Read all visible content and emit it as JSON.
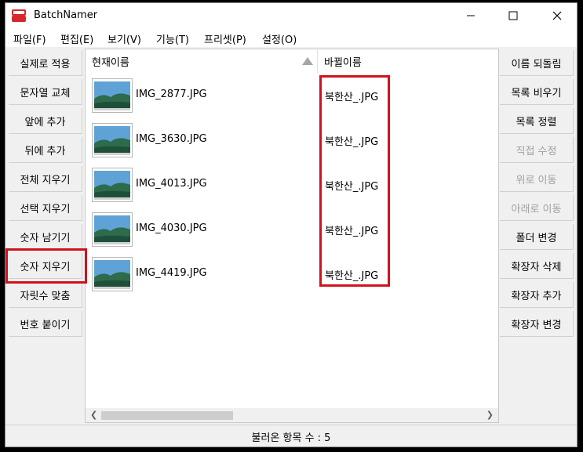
{
  "window": {
    "title": "BatchNamer"
  },
  "menu": [
    "파일(F)",
    "편집(E)",
    "보기(V)",
    "기능(T)",
    "프리셋(P)",
    "설정(O)"
  ],
  "left_buttons": [
    {
      "label": "실제로 적용",
      "enabled": true
    },
    {
      "label": "문자열 교체",
      "enabled": true
    },
    {
      "label": "앞에 추가",
      "enabled": true
    },
    {
      "label": "뒤에 추가",
      "enabled": true
    },
    {
      "label": "전체 지우기",
      "enabled": true
    },
    {
      "label": "선택 지우기",
      "enabled": true
    },
    {
      "label": "숫자 남기기",
      "enabled": true
    },
    {
      "label": "숫자 지우기",
      "enabled": true
    },
    {
      "label": "자릿수 맞춤",
      "enabled": true
    },
    {
      "label": "번호 붙이기",
      "enabled": true
    }
  ],
  "right_buttons": [
    {
      "label": "이름 되돌림",
      "enabled": true
    },
    {
      "label": "목록 비우기",
      "enabled": true
    },
    {
      "label": "목록 정렬",
      "enabled": true
    },
    {
      "label": "직접 수정",
      "enabled": false
    },
    {
      "label": "위로 이동",
      "enabled": false
    },
    {
      "label": "아래로 이동",
      "enabled": false
    },
    {
      "label": "폴더 변경",
      "enabled": true
    },
    {
      "label": "확장자 삭제",
      "enabled": true
    },
    {
      "label": "확장자 추가",
      "enabled": true
    },
    {
      "label": "확장자 변경",
      "enabled": true
    }
  ],
  "columns": {
    "current": "현재이름",
    "new": "바뀔이름"
  },
  "files": [
    {
      "current": "IMG_2877.JPG",
      "new": "북한산_.JPG"
    },
    {
      "current": "IMG_3630.JPG",
      "new": "북한산_.JPG"
    },
    {
      "current": "IMG_4013.JPG",
      "new": "북한산_.JPG"
    },
    {
      "current": "IMG_4030.JPG",
      "new": "북한산_.JPG"
    },
    {
      "current": "IMG_4419.JPG",
      "new": "북한산_.JPG"
    }
  ],
  "status": "불러온 항목 수 : 5",
  "colors": {
    "highlight": "#d0121b",
    "app_icon": "#d9252c"
  }
}
